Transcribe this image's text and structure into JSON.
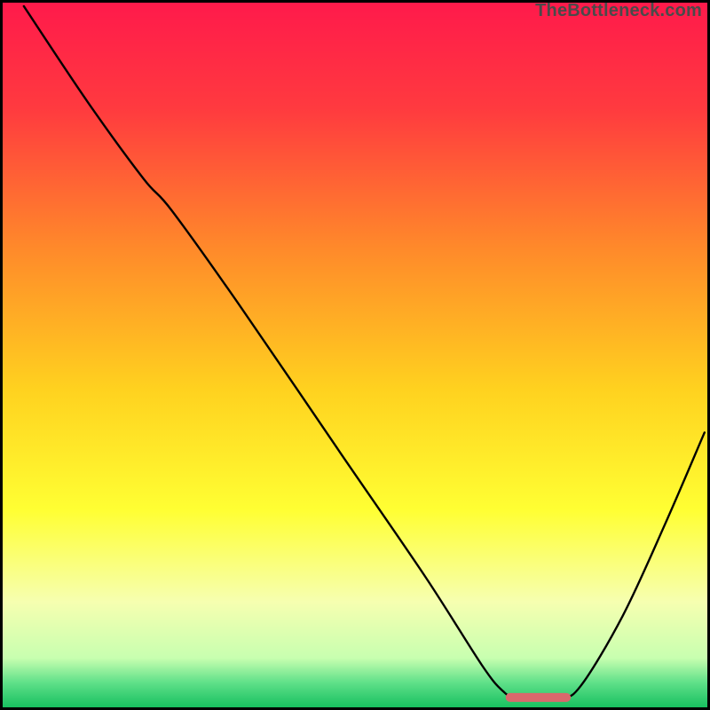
{
  "meta": {
    "attribution": "TheBottleneck.com"
  },
  "chart_data": {
    "type": "line",
    "title": "",
    "xlabel": "",
    "ylabel": "",
    "xlim": [
      0,
      100
    ],
    "ylim": [
      0,
      100
    ],
    "background_gradient": {
      "stops": [
        {
          "offset": 0.0,
          "color": "#ff1a4b"
        },
        {
          "offset": 0.15,
          "color": "#ff3a3f"
        },
        {
          "offset": 0.35,
          "color": "#ff8a2a"
        },
        {
          "offset": 0.55,
          "color": "#ffd21f"
        },
        {
          "offset": 0.72,
          "color": "#ffff33"
        },
        {
          "offset": 0.85,
          "color": "#f6ffb0"
        },
        {
          "offset": 0.93,
          "color": "#c8ffb0"
        },
        {
          "offset": 0.965,
          "color": "#5fe089"
        },
        {
          "offset": 1.0,
          "color": "#18c060"
        }
      ]
    },
    "series": [
      {
        "name": "bottleneck-curve",
        "type": "line",
        "color": "#000000",
        "stroke_width": 2.4,
        "points": [
          {
            "x": 3.0,
            "y": 99.5
          },
          {
            "x": 12.0,
            "y": 86.0
          },
          {
            "x": 20.0,
            "y": 75.0
          },
          {
            "x": 24.0,
            "y": 70.5
          },
          {
            "x": 34.0,
            "y": 56.5
          },
          {
            "x": 48.0,
            "y": 36.0
          },
          {
            "x": 60.0,
            "y": 18.5
          },
          {
            "x": 68.0,
            "y": 6.0
          },
          {
            "x": 71.0,
            "y": 2.3
          },
          {
            "x": 73.0,
            "y": 1.4
          },
          {
            "x": 79.0,
            "y": 1.4
          },
          {
            "x": 82.0,
            "y": 3.0
          },
          {
            "x": 88.0,
            "y": 13.0
          },
          {
            "x": 94.0,
            "y": 26.0
          },
          {
            "x": 99.6,
            "y": 39.0
          }
        ]
      },
      {
        "name": "highlight-segment",
        "type": "segment",
        "color": "#d9686c",
        "stroke_width": 10,
        "linecap": "round",
        "x0": 72.0,
        "y0": 1.4,
        "x1": 80.0,
        "y1": 1.4
      }
    ]
  }
}
